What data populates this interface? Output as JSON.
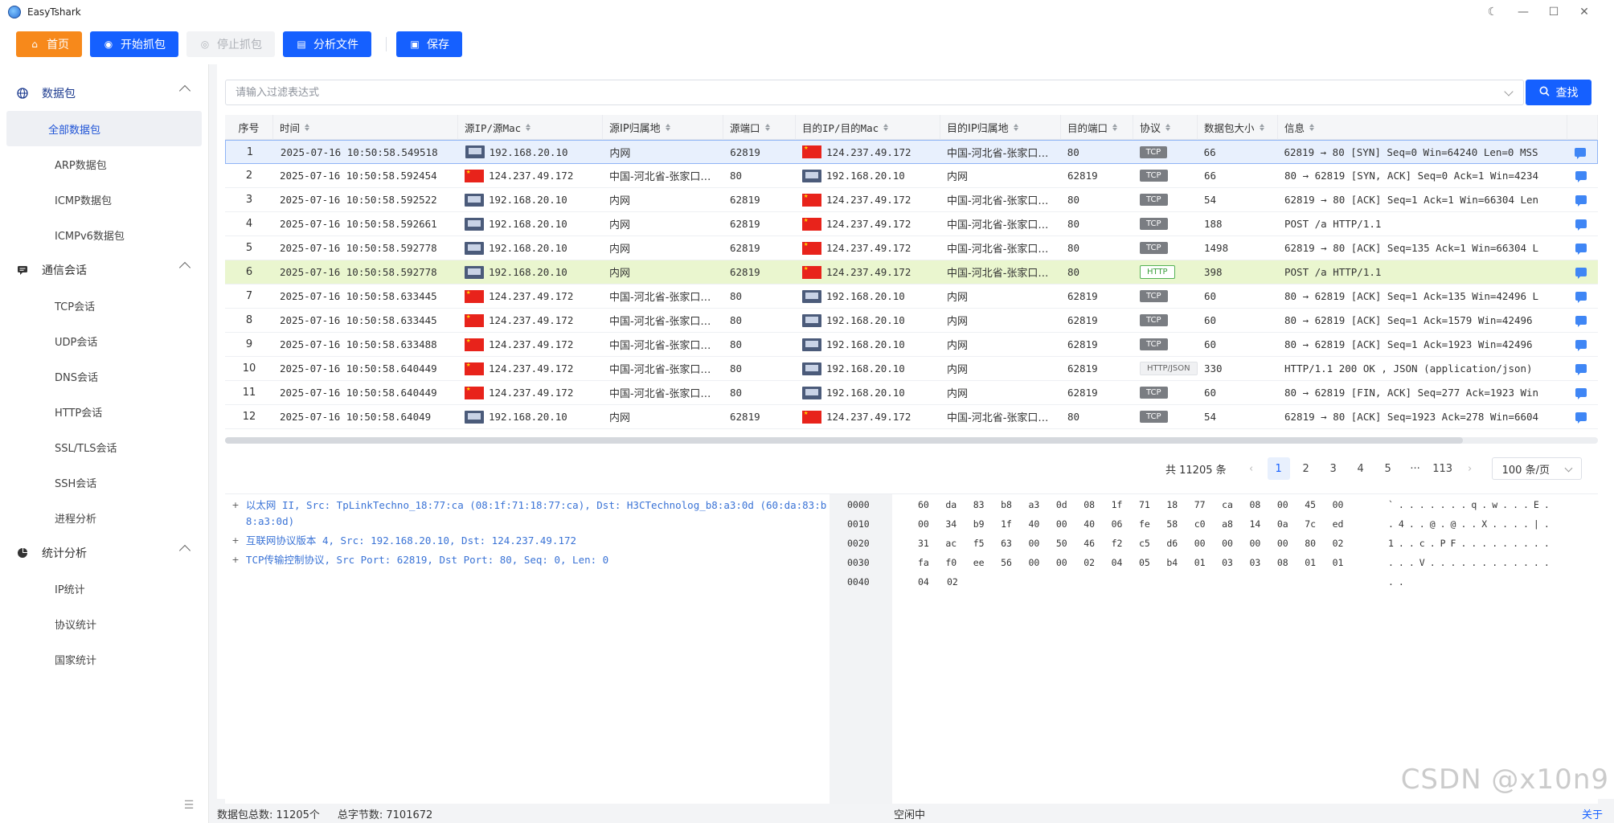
{
  "app": {
    "title": "EasyTshark"
  },
  "window_controls": [
    "☾",
    "—",
    "☐",
    "✕"
  ],
  "toolbar": {
    "home": "首页",
    "start_capture": "开始抓包",
    "stop_capture": "停止抓包",
    "analyze_file": "分析文件",
    "save": "保存"
  },
  "sidebar": {
    "groups": [
      {
        "label": "数据包",
        "items": [
          "全部数据包",
          "ARP数据包",
          "ICMP数据包",
          "ICMPv6数据包"
        ]
      },
      {
        "label": "通信会话",
        "items": [
          "TCP会话",
          "UDP会话",
          "DNS会话",
          "HTTP会话",
          "SSL/TLS会话",
          "SSH会话",
          "进程分析"
        ]
      },
      {
        "label": "统计分析",
        "items": [
          "IP统计",
          "协议统计",
          "国家统计"
        ]
      }
    ]
  },
  "filter": {
    "placeholder": "请输入过滤表达式",
    "search_label": "查找"
  },
  "table": {
    "headers": [
      "序号",
      "时间",
      "源IP/源Mac",
      "源IP归属地",
      "源端口",
      "目的IP/目的Mac",
      "目的IP归属地",
      "目的端口",
      "协议",
      "数据包大小",
      "信息"
    ],
    "rows": [
      [
        "1",
        "2025-07-16 10:50:58.549518",
        "pc",
        "192.168.20.10",
        "内网",
        "62819",
        "cn",
        "124.237.49.172",
        "中国-河北省-张家口…",
        "80",
        "TCP",
        "66",
        "62819 → 80 [SYN] Seq=0 Win=64240 Len=0 MSS"
      ],
      [
        "2",
        "2025-07-16 10:50:58.592454",
        "cn",
        "124.237.49.172",
        "中国-河北省-张家口…",
        "80",
        "pc",
        "192.168.20.10",
        "内网",
        "62819",
        "TCP",
        "66",
        "80 → 62819 [SYN, ACK] Seq=0 Ack=1 Win=4234"
      ],
      [
        "3",
        "2025-07-16 10:50:58.592522",
        "pc",
        "192.168.20.10",
        "内网",
        "62819",
        "cn",
        "124.237.49.172",
        "中国-河北省-张家口…",
        "80",
        "TCP",
        "54",
        "62819 → 80 [ACK] Seq=1 Ack=1 Win=66304 Len"
      ],
      [
        "4",
        "2025-07-16 10:50:58.592661",
        "pc",
        "192.168.20.10",
        "内网",
        "62819",
        "cn",
        "124.237.49.172",
        "中国-河北省-张家口…",
        "80",
        "TCP",
        "188",
        "POST /a HTTP/1.1"
      ],
      [
        "5",
        "2025-07-16 10:50:58.592778",
        "pc",
        "192.168.20.10",
        "内网",
        "62819",
        "cn",
        "124.237.49.172",
        "中国-河北省-张家口…",
        "80",
        "TCP",
        "1498",
        "62819 → 80 [ACK] Seq=135 Ack=1 Win=66304 L"
      ],
      [
        "6",
        "2025-07-16 10:50:58.592778",
        "pc",
        "192.168.20.10",
        "内网",
        "62819",
        "cn",
        "124.237.49.172",
        "中国-河北省-张家口…",
        "80",
        "HTTP",
        "398",
        "POST /a HTTP/1.1"
      ],
      [
        "7",
        "2025-07-16 10:50:58.633445",
        "cn",
        "124.237.49.172",
        "中国-河北省-张家口…",
        "80",
        "pc",
        "192.168.20.10",
        "内网",
        "62819",
        "TCP",
        "60",
        "80 → 62819 [ACK] Seq=1 Ack=135 Win=42496 L"
      ],
      [
        "8",
        "2025-07-16 10:50:58.633445",
        "cn",
        "124.237.49.172",
        "中国-河北省-张家口…",
        "80",
        "pc",
        "192.168.20.10",
        "内网",
        "62819",
        "TCP",
        "60",
        "80 → 62819 [ACK] Seq=1 Ack=1579 Win=42496"
      ],
      [
        "9",
        "2025-07-16 10:50:58.633488",
        "cn",
        "124.237.49.172",
        "中国-河北省-张家口…",
        "80",
        "pc",
        "192.168.20.10",
        "内网",
        "62819",
        "TCP",
        "60",
        "80 → 62819 [ACK] Seq=1 Ack=1923 Win=42496"
      ],
      [
        "10",
        "2025-07-16 10:50:58.640449",
        "cn",
        "124.237.49.172",
        "中国-河北省-张家口…",
        "80",
        "pc",
        "192.168.20.10",
        "内网",
        "62819",
        "HTTP/JSON",
        "330",
        "HTTP/1.1 200 OK , JSON (application/json)"
      ],
      [
        "11",
        "2025-07-16 10:50:58.640449",
        "cn",
        "124.237.49.172",
        "中国-河北省-张家口…",
        "80",
        "pc",
        "192.168.20.10",
        "内网",
        "62819",
        "TCP",
        "60",
        "80 → 62819 [FIN, ACK] Seq=277 Ack=1923 Win"
      ],
      [
        "12",
        "2025-07-16 10:50:58.64049",
        "pc",
        "192.168.20.10",
        "内网",
        "62819",
        "cn",
        "124.237.49.172",
        "中国-河北省-张家口…",
        "80",
        "TCP",
        "54",
        "62819 → 80 [ACK] Seq=1923 Ack=278 Win=6604"
      ]
    ]
  },
  "pagination": {
    "total": "共 11205 条",
    "prev": "‹",
    "pages": [
      "1",
      "2",
      "3",
      "4",
      "5",
      "···",
      "113"
    ],
    "next": "›",
    "page_size": "100 条/页"
  },
  "detail_tree": [
    "以太网 II, Src: TpLinkTechno_18:77:ca (08:1f:71:18:77:ca), Dst: H3CTechnolog_b8:a3:0d (60:da:83:b8:a3:0d)",
    "互联网协议版本 4, Src: 192.168.20.10, Dst: 124.237.49.172",
    "TCP传输控制协议, Src Port: 62819, Dst Port: 80, Seq: 0, Len: 0"
  ],
  "hex": {
    "offsets": [
      "0000",
      "0010",
      "0020",
      "0030",
      "0040"
    ],
    "bytes": [
      [
        "60",
        "da",
        "83",
        "b8",
        "a3",
        "0d",
        "08",
        "1f",
        "71",
        "18",
        "77",
        "ca",
        "08",
        "00",
        "45",
        "00"
      ],
      [
        "00",
        "34",
        "b9",
        "1f",
        "40",
        "00",
        "40",
        "06",
        "fe",
        "58",
        "c0",
        "a8",
        "14",
        "0a",
        "7c",
        "ed"
      ],
      [
        "31",
        "ac",
        "f5",
        "63",
        "00",
        "50",
        "46",
        "f2",
        "c5",
        "d6",
        "00",
        "00",
        "00",
        "00",
        "80",
        "02"
      ],
      [
        "fa",
        "f0",
        "ee",
        "56",
        "00",
        "00",
        "02",
        "04",
        "05",
        "b4",
        "01",
        "03",
        "03",
        "08",
        "01",
        "01"
      ],
      [
        "04",
        "02"
      ]
    ],
    "ascii": [
      "`.......q.w...E.",
      ".4..@.@..X....|.",
      "1..c.PF.........",
      "...V............",
      ".."
    ]
  },
  "status": {
    "packet_count": "数据包总数: 11205个",
    "byte_count": "总字节数: 7101672",
    "state": "空闲中",
    "about": "关于"
  },
  "watermark": "CSDN @x10n9",
  "colors": {
    "primary": "#1560ff",
    "home": "#f7891b",
    "selected_row": "#e8f0fd",
    "http_row": "#eaf6cf"
  }
}
